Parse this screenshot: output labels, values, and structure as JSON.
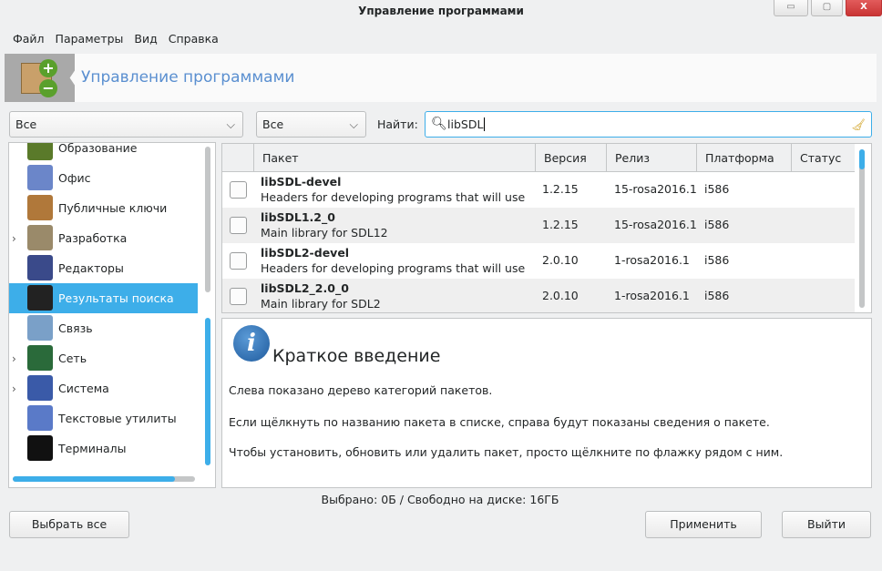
{
  "window": {
    "title": "Управление программами",
    "min": "▭",
    "max": "▢",
    "close": "X"
  },
  "menu": [
    "Файл",
    "Параметры",
    "Вид",
    "Справка"
  ],
  "banner": {
    "title": "Управление программами"
  },
  "filters": {
    "group": "Все",
    "state": "Все",
    "search_label": "Найти:",
    "search_value": "libSDL"
  },
  "tree": [
    {
      "label": "Образование",
      "expand": false,
      "color": "#5a7a2a"
    },
    {
      "label": "Офис",
      "expand": false,
      "color": "#6b86c9"
    },
    {
      "label": "Публичные ключи",
      "expand": false,
      "color": "#b0783a"
    },
    {
      "label": "Разработка",
      "expand": true,
      "color": "#9a8a6a"
    },
    {
      "label": "Редакторы",
      "expand": false,
      "color": "#3a4a8a"
    },
    {
      "label": "Результаты поиска",
      "expand": false,
      "color": "#222",
      "selected": true
    },
    {
      "label": "Связь",
      "expand": false,
      "color": "#7aa0c8"
    },
    {
      "label": "Сеть",
      "expand": true,
      "color": "#2a6a3a"
    },
    {
      "label": "Система",
      "expand": true,
      "color": "#3a5aa8"
    },
    {
      "label": "Текстовые утилиты",
      "expand": false,
      "color": "#5a7ac8"
    },
    {
      "label": "Терминалы",
      "expand": false,
      "color": "#111"
    }
  ],
  "table": {
    "headers": [
      "Пакет",
      "Версия",
      "Релиз",
      "Платформа",
      "Статус"
    ],
    "rows": [
      {
        "name": "libSDL-devel",
        "desc": "Headers for developing programs that will use Simple DirectMedia Layer",
        "version": "1.2.15",
        "release": "15-rosa2016.1",
        "platform": "i586",
        "status": ""
      },
      {
        "name": "libSDL1.2_0",
        "desc": "Main library for SDL12",
        "version": "1.2.15",
        "release": "15-rosa2016.1",
        "platform": "i586",
        "status": ""
      },
      {
        "name": "libSDL2-devel",
        "desc": "Headers for developing programs that will use Simple DirectMedia Layer",
        "version": "2.0.10",
        "release": "1-rosa2016.1",
        "platform": "i586",
        "status": ""
      },
      {
        "name": "libSDL2_2.0_0",
        "desc": "Main library for SDL2",
        "version": "2.0.10",
        "release": "1-rosa2016.1",
        "platform": "i586",
        "status": ""
      }
    ]
  },
  "info": {
    "title": "Краткое введение",
    "icon": "i",
    "lines": [
      "Слева показано дерево категорий пакетов.",
      "Если щёлкнуть по названию пакета в списке, справа будут показаны сведения о пакете.",
      "Чтобы установить, обновить или удалить пакет, просто щёлкните по флажку рядом с ним."
    ]
  },
  "status": "Выбрано: 0Б / Свободно на диске: 16ГБ",
  "buttons": {
    "select_all": "Выбрать все",
    "apply": "Применить",
    "quit": "Выйти"
  }
}
